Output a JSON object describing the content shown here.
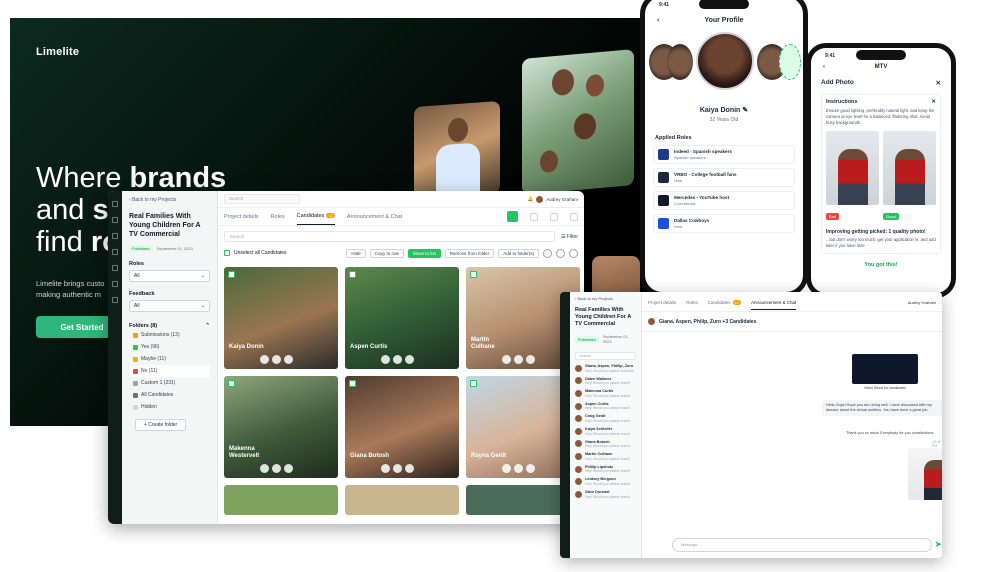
{
  "hero": {
    "logo": "Limelite",
    "headline_1_plain": "Where ",
    "headline_1_bold": "brands",
    "headline_2_plain": "and ",
    "headline_2_bold": "studios",
    "headline_3_plain": "find ",
    "headline_3_bold": "ro",
    "sub_1": "Limelite brings custo",
    "sub_2": "making authentic m",
    "cta": "Get Started"
  },
  "app": {
    "back": "Back to my Projects",
    "project_title": "Real Families With Young Children For A TV Commercial",
    "status": "Published",
    "date": "September 01, 2023",
    "roles_label": "Roles",
    "roles_value": "All",
    "feedback_label": "Feedback",
    "feedback_value": "All",
    "folders_label": "Folders (8)",
    "folders": [
      {
        "label": "Submissions (13)",
        "color": "#f59e0b"
      },
      {
        "label": "Yes (96)",
        "color": "#22c55e"
      },
      {
        "label": "Maybe (11)",
        "color": "#eab308"
      },
      {
        "label": "No (11)",
        "color": "#ef4444"
      },
      {
        "label": "Custom 1 (231)",
        "color": "#9ca3af"
      },
      {
        "label": "All Candidates",
        "color": "#6b7280"
      },
      {
        "label": "Hidden",
        "color": "#d1d5db"
      }
    ],
    "create_folder": "+ Create folder",
    "search_placeholder": "Search",
    "user_name": "Audrey Graham",
    "tabs": [
      "Project details",
      "Roles",
      "Candidates",
      "Announcement & Chat"
    ],
    "candidates_badge": "12",
    "filter": "Filter",
    "unselect": "Unselect all Candidates",
    "actions": [
      "Hide",
      "Copy to role",
      "Move to list",
      "Remove from folder",
      "Add to folder(s)"
    ],
    "cards": [
      {
        "name": "Kaiya Donin",
        "bg": "linear-gradient(160deg,#4a6b3a,#9a7552 55%,#2b2b2b)"
      },
      {
        "name": "Aspen Curtis",
        "bg": "linear-gradient(160deg,#5c8a4a,#2e5a34 55%,#1d2e1f)"
      },
      {
        "name": "Martin Culhane",
        "bg": "linear-gradient(160deg,#d9c6a8,#b58d6e 55%,#5a4636)"
      },
      {
        "name": "Makenna Westervelt",
        "bg": "linear-gradient(160deg,#8fa57d,#3f5a39 55%,#1f2b1c)"
      },
      {
        "name": "Giana Botosh",
        "bg": "linear-gradient(160deg,#4f3c2f,#a97a5a 55%,#2a211b)"
      },
      {
        "name": "Rayna Geidt",
        "bg": "linear-gradient(160deg,#bfd6e6,#d8b499 55%,#8c6b55)"
      }
    ]
  },
  "profile": {
    "time": "9:41",
    "title": "Your Profile",
    "name": "Kaiya Donin",
    "age": "32 Years Old",
    "roles_label": "Applied Roles",
    "roles": [
      {
        "title": "Indeed - Spanish speakers",
        "sub": "Spanish speakers",
        "color": "#1e3a8a"
      },
      {
        "title": "VRBO - College football fans",
        "sub": "Host",
        "color": "#1e293b"
      },
      {
        "title": "Mercedes - YouTube host",
        "sub": "Commercial",
        "color": "#111827"
      },
      {
        "title": "Dallas Cowboys",
        "sub": "Host",
        "color": "#1d4ed8"
      }
    ]
  },
  "photo_sheet": {
    "time": "9:41",
    "app_title": "MTV",
    "title": "Add Photo",
    "instructions_label": "Instructions",
    "instructions": "Ensure good lighting, preferably natural light, and keep the camera at eye level for a balanced, flattering shot. Avoid busy backgrounds.",
    "bad_tag": "Bad",
    "good_tag": "Good",
    "tip_title": "Improving getting picked: 1 quality photo!",
    "tip_text": "...but don't worry too much, get your application in, and add later if you have time",
    "got_it": "You got this!"
  },
  "chat": {
    "back": "Back to my Projects",
    "project_title": "Real Families With Young Children For A TV Commercial",
    "status": "Published",
    "date": "September 01, 2023",
    "search_placeholder": "Search",
    "tabs": [
      "Project details",
      "Roles",
      "Candidates",
      "Announcement & Chat"
    ],
    "badge": "12",
    "user_name": "Audrey Graham",
    "header": "Giana, Aspen, Philip, Zuro +3 Candidates",
    "conversations": [
      {
        "name": "Giana, Aspen, Phillip, Zuro",
        "msg": "Hey! Would you please read this"
      },
      {
        "name": "Dalen Wallmor",
        "msg": "Hey! Would you please read it"
      },
      {
        "name": "Makenna Curtis",
        "msg": "Hey! Would you please read it"
      },
      {
        "name": "Aspen Curtis",
        "msg": "Hey! Would you please read it"
      },
      {
        "name": "Craig Geidt",
        "msg": "Hey! Would you please read it"
      },
      {
        "name": "Kaiya Schleifer",
        "msg": "Hey! Would you please read it"
      },
      {
        "name": "Giana Botosh",
        "msg": "Hey! Would you please read it"
      },
      {
        "name": "Martin Culhane",
        "msg": "Hey! Would you please read it"
      },
      {
        "name": "Phillip Lipshutz",
        "msg": "Hey! Would you please read it"
      },
      {
        "name": "Lindsey Bergson",
        "msg": "Hey! Would you please read it"
      },
      {
        "name": "Zaire Dorwart",
        "msg": "Hey! Would you please read it"
      }
    ],
    "video_caption": "Video Shoot for candidates",
    "message_1": "Hello Guys! Hope you are doing well. I have discussed with my director about the virtual audition. You have done a great job.",
    "message_2": "Thank you so much Everybody for you contributions",
    "time_1": "13:42 PM",
    "composer_placeholder": "Message..."
  }
}
